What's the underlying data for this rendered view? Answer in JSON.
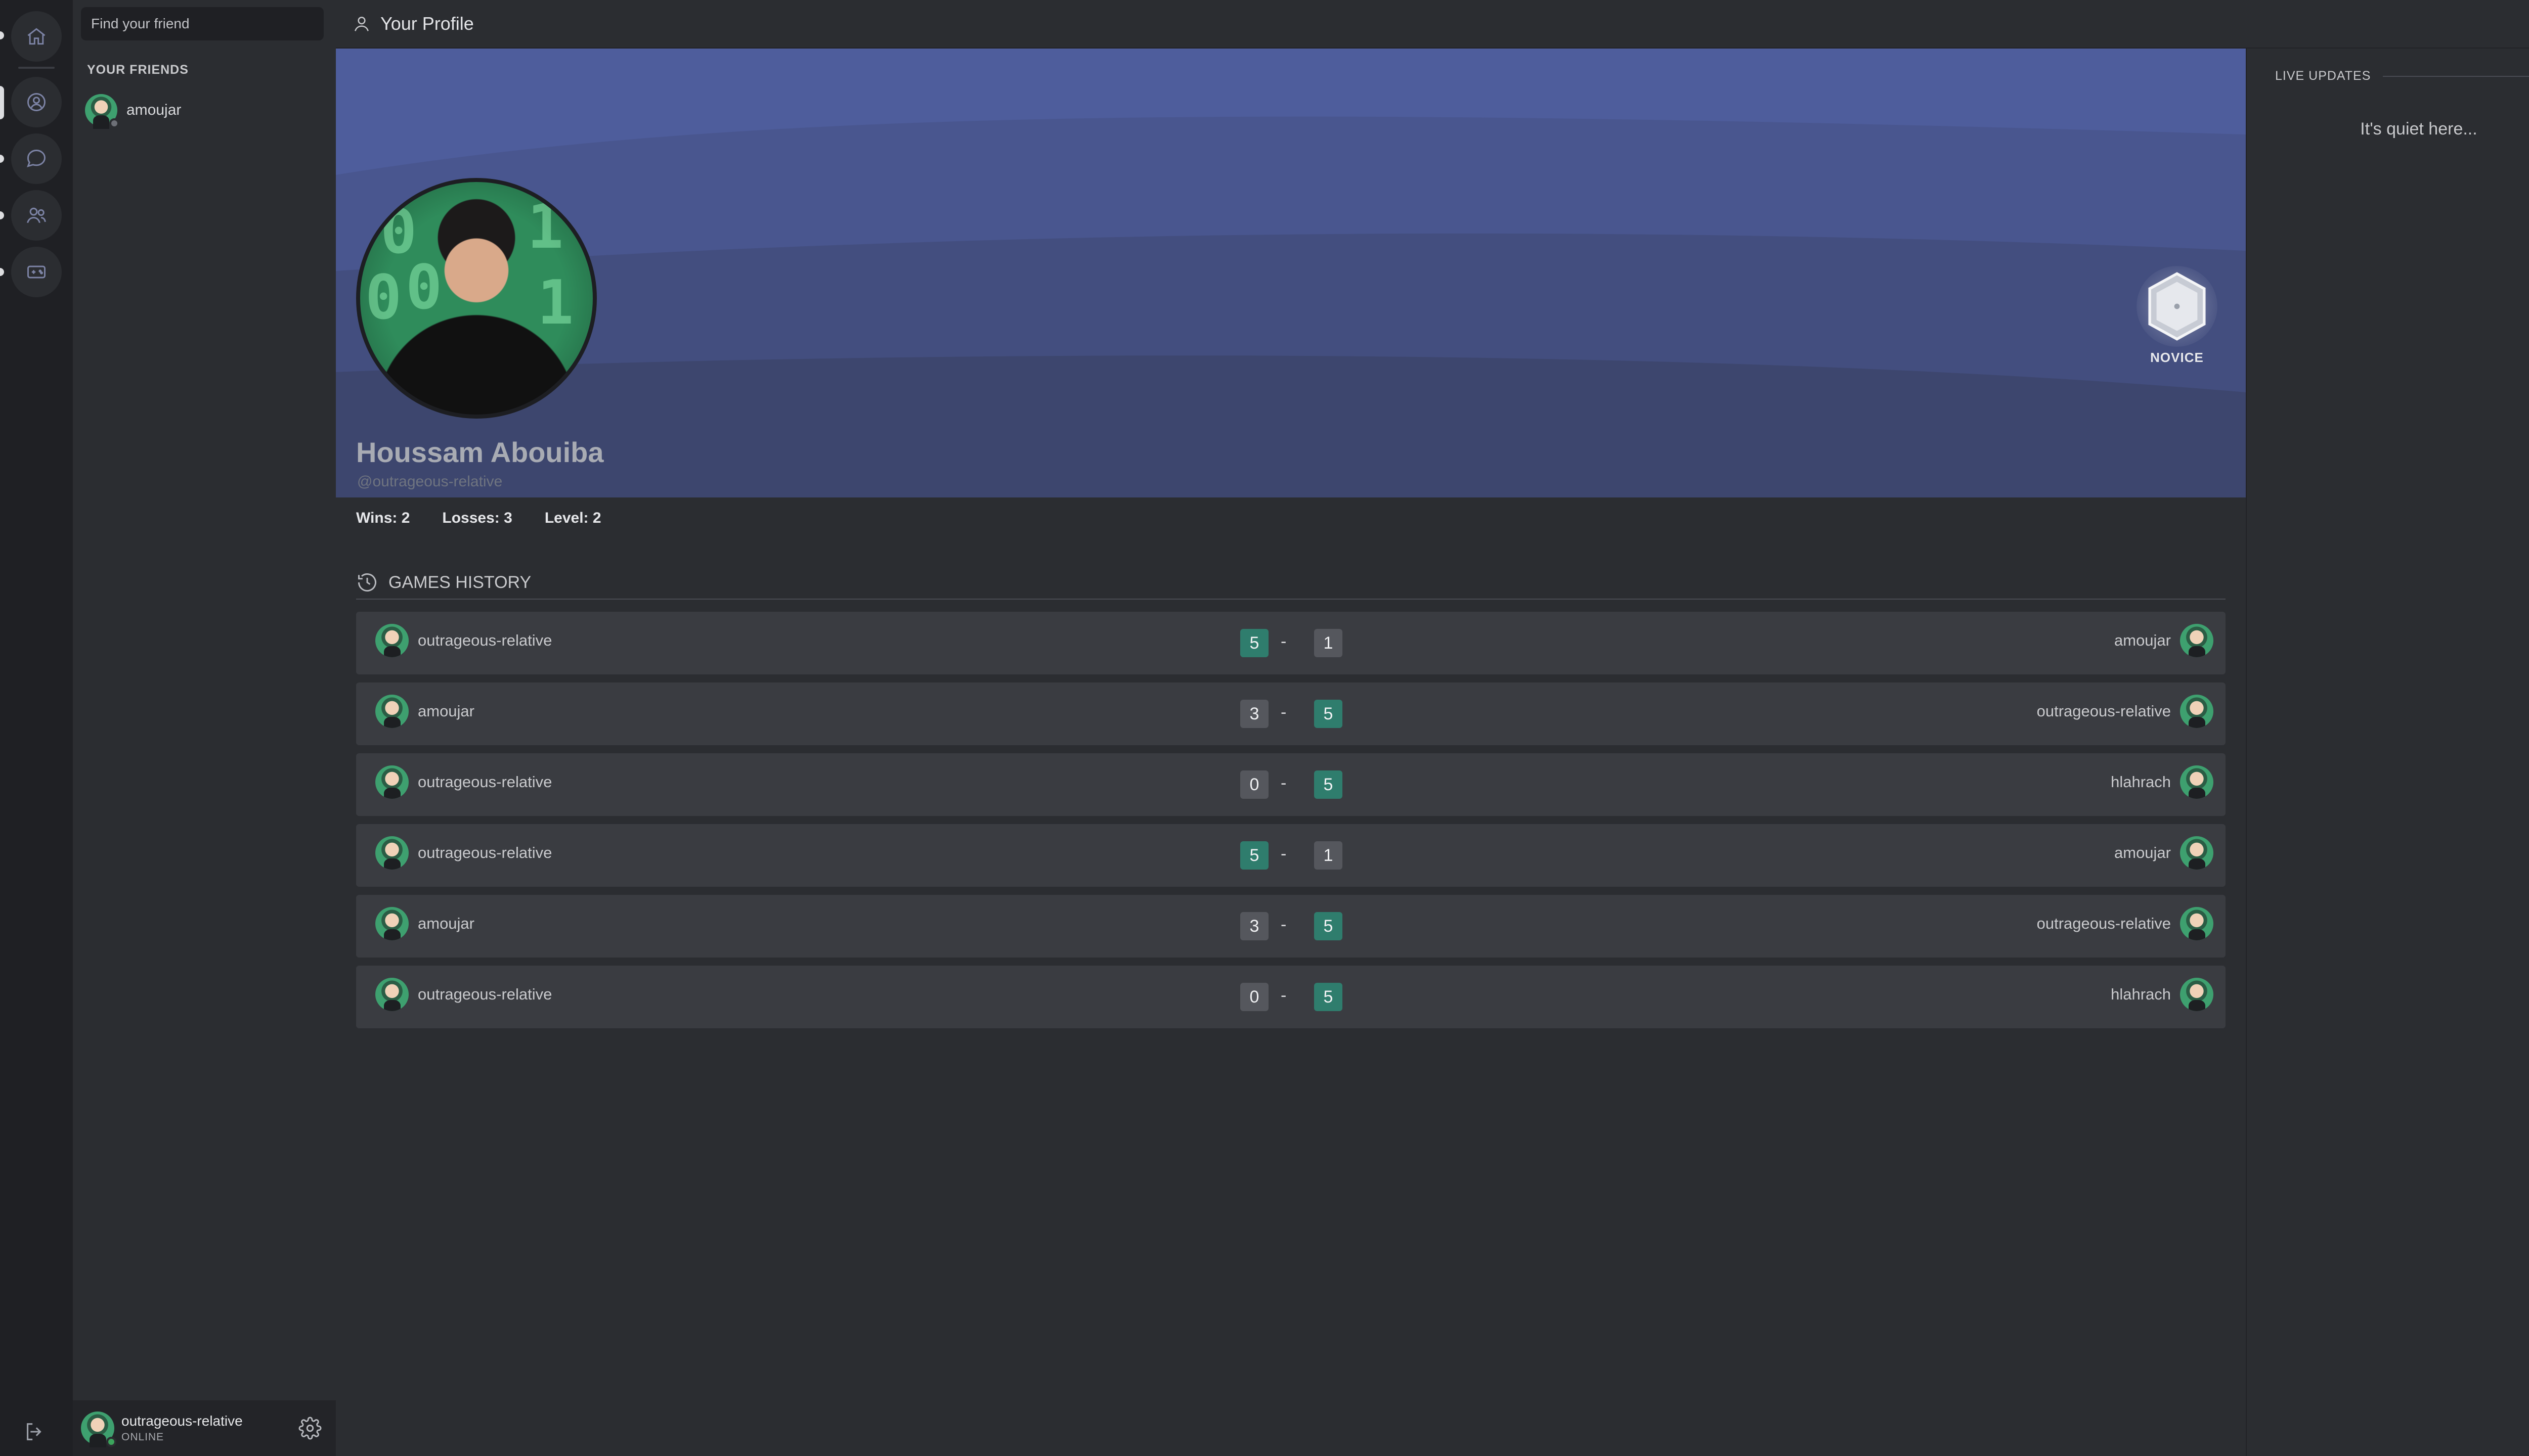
{
  "search": {
    "placeholder": "Find your friend"
  },
  "friends": {
    "section_title": "YOUR FRIENDS",
    "items": [
      {
        "name": "amoujar",
        "status": "offline"
      }
    ]
  },
  "current_user": {
    "username": "outrageous-relative",
    "status": "ONLINE"
  },
  "header": {
    "title": "Your Profile",
    "icon": "user-icon"
  },
  "profile": {
    "full_name": "Houssam Abouiba",
    "handle": "@outrageous-relative",
    "rank": "NOVICE",
    "stats": {
      "wins": "Wins: 2",
      "losses": "Losses: 3",
      "level": "Level: 2"
    },
    "avatar_digits": [
      "0",
      "1",
      "0",
      "1",
      "0"
    ]
  },
  "history": {
    "title": "GAMES HISTORY",
    "games": [
      {
        "left": "outrageous-relative",
        "left_score": "5",
        "right_score": "1",
        "right": "amoujar",
        "winner": "left"
      },
      {
        "left": "amoujar",
        "left_score": "3",
        "right_score": "5",
        "right": "outrageous-relative",
        "winner": "right"
      },
      {
        "left": "outrageous-relative",
        "left_score": "0",
        "right_score": "5",
        "right": "hlahrach",
        "winner": "right"
      },
      {
        "left": "outrageous-relative",
        "left_score": "5",
        "right_score": "1",
        "right": "amoujar",
        "winner": "left"
      },
      {
        "left": "amoujar",
        "left_score": "3",
        "right_score": "5",
        "right": "outrageous-relative",
        "winner": "right"
      },
      {
        "left": "outrageous-relative",
        "left_score": "0",
        "right_score": "5",
        "right": "hlahrach",
        "winner": "right"
      }
    ],
    "separator": "-"
  },
  "live_updates": {
    "title": "LIVE UPDATES",
    "empty_text": "It's quiet here..."
  },
  "colors": {
    "win": "#2f7d6d",
    "lose": "#55575d",
    "banner": "#4e5d9c",
    "online": "#3ba55c"
  }
}
